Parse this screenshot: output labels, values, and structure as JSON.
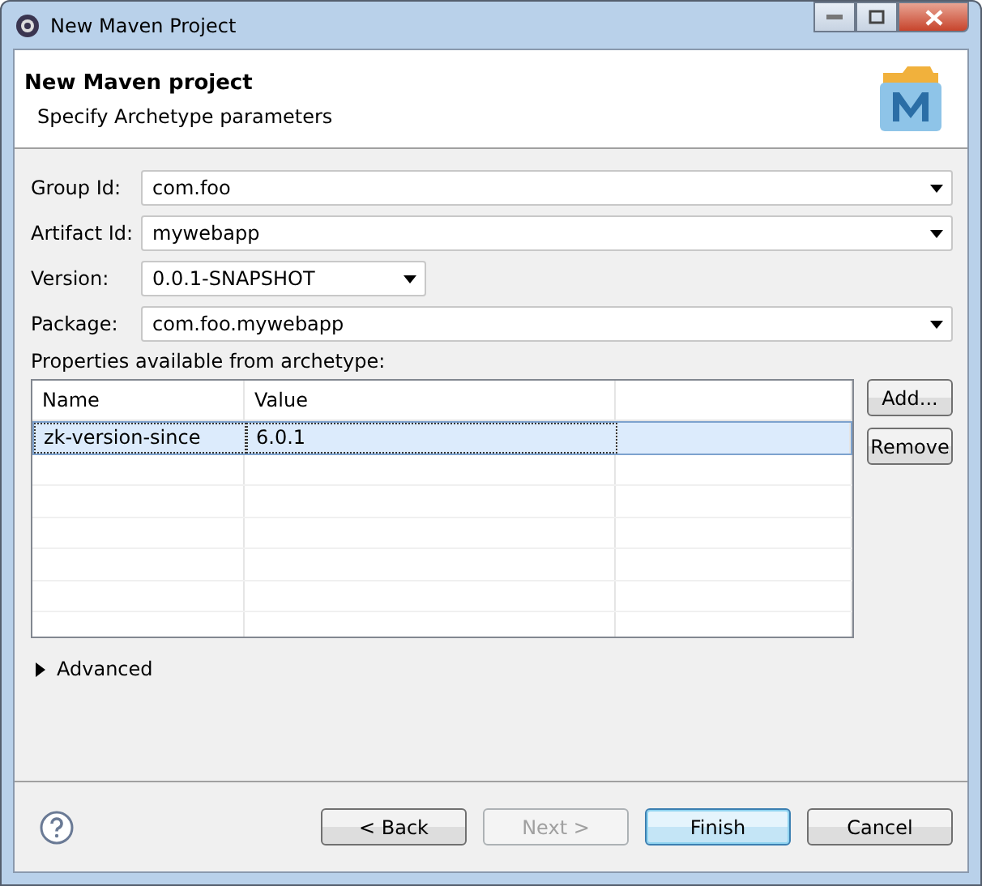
{
  "window": {
    "title": "New Maven Project"
  },
  "header": {
    "title": "New Maven project",
    "subtitle": "Specify Archetype parameters"
  },
  "fields": [
    {
      "label": "Group Id:",
      "value": "com.foo",
      "wide": true
    },
    {
      "label": "Artifact Id:",
      "value": "mywebapp",
      "wide": true
    },
    {
      "label": "Version:",
      "value": "0.0.1-SNAPSHOT",
      "wide": false
    },
    {
      "label": "Package:",
      "value": "com.foo.mywebapp",
      "wide": true
    }
  ],
  "properties": {
    "label": "Properties available from archetype:",
    "columns": [
      "Name",
      "Value"
    ],
    "rows": [
      {
        "name": "zk-version-since",
        "value": "6.0.1",
        "selected": true
      }
    ],
    "buttons": [
      "Add...",
      "Remove"
    ]
  },
  "advanced": {
    "label": "Advanced",
    "expanded": false
  },
  "buttons": [
    {
      "label": "< Back",
      "disabled": false,
      "default": false
    },
    {
      "label": "Next >",
      "disabled": true,
      "default": false
    },
    {
      "label": "Finish",
      "disabled": false,
      "default": true
    },
    {
      "label": "Cancel",
      "disabled": false,
      "default": false
    }
  ]
}
